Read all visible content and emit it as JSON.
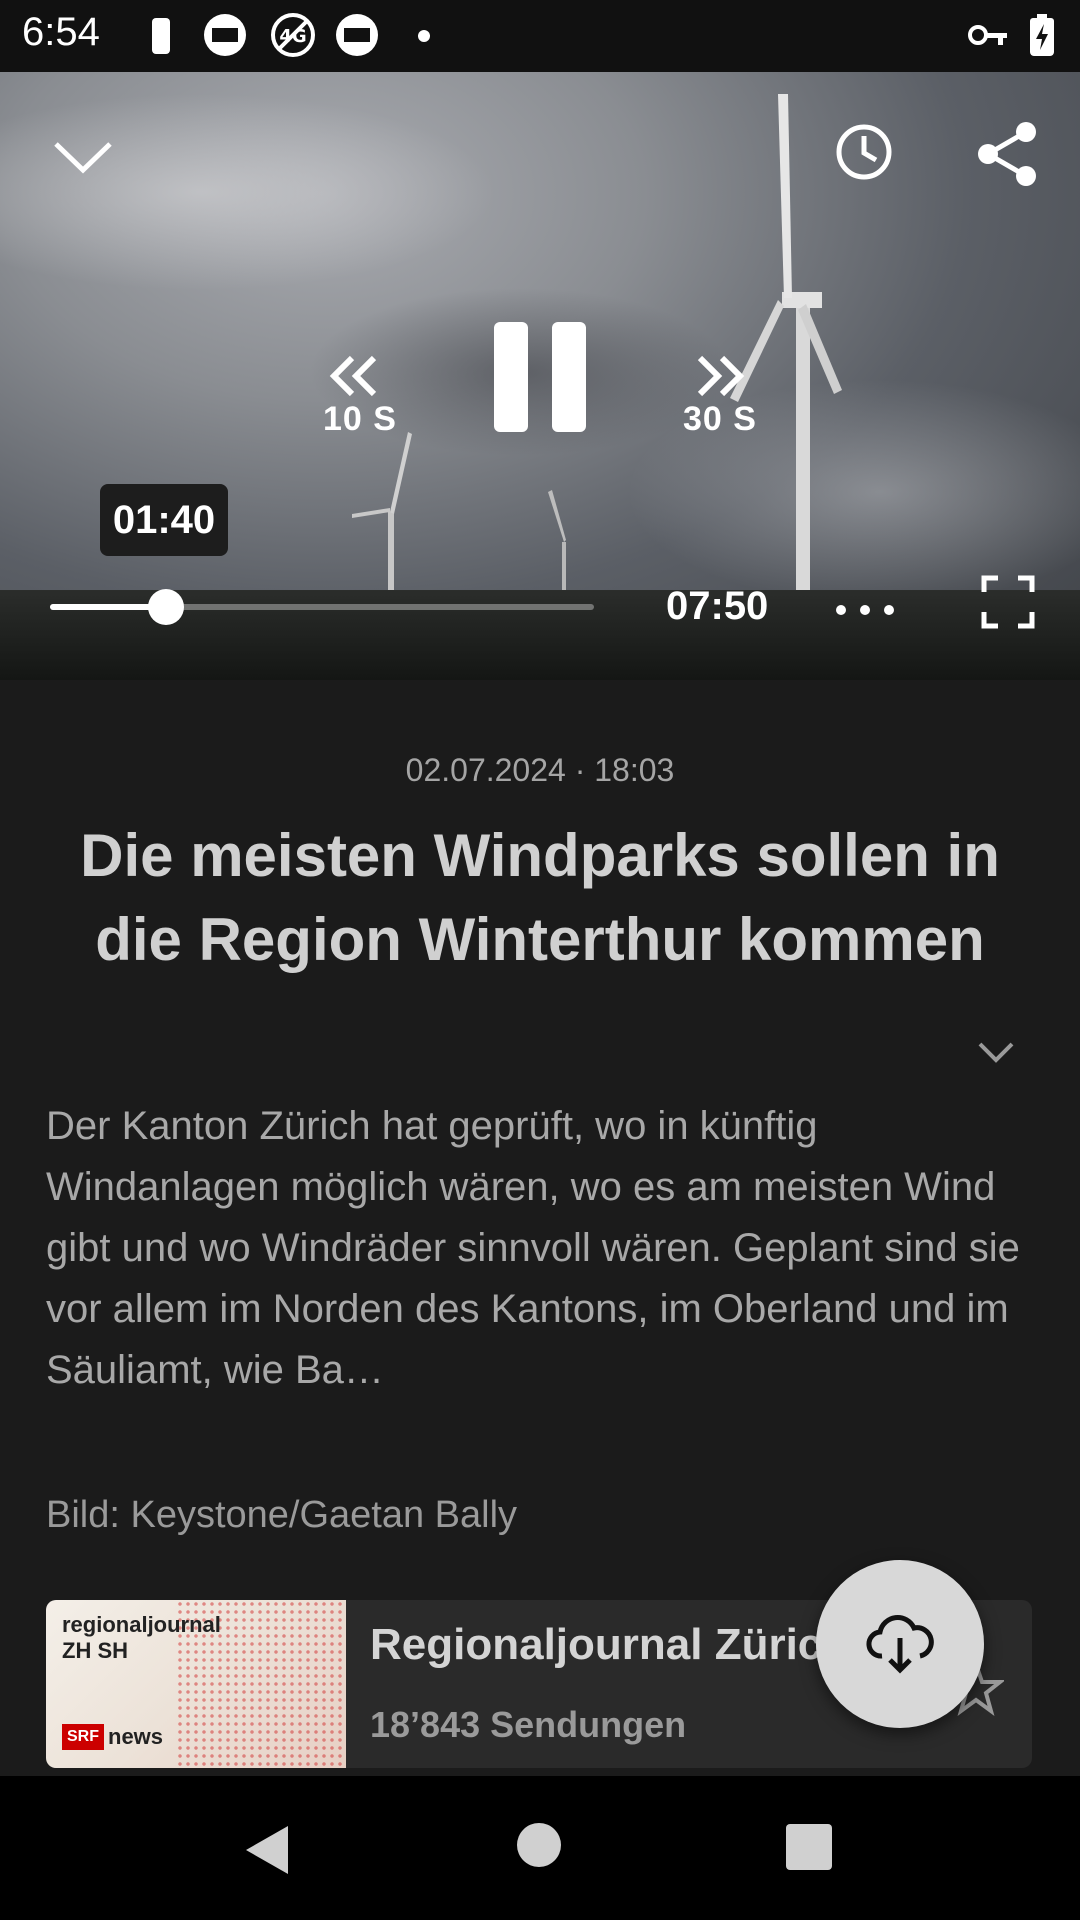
{
  "status_bar": {
    "time": "6:54"
  },
  "player": {
    "rewind_label": "10 S",
    "forward_label": "30 S",
    "seek_tooltip": "01:40",
    "duration": "07:50",
    "progress_fraction": 0.213
  },
  "episode": {
    "datetime": "02.07.2024 · 18:03",
    "title": "Die meisten Windparks sollen in die Region Winterthur kommen",
    "description": "Der Kanton Zürich hat geprüft, wo in künftig Windanlagen möglich wären, wo es am meisten Wind gibt und wo Windräder sinnvoll wären. Geplant sind sie vor allem im Norden des Kantons, im Oberland und im Säuliamt, wie Ba…",
    "image_credit": "Bild: Keystone/Gaetan Bally"
  },
  "show": {
    "thumb_line1": "regionaljournal",
    "thumb_line2": "ZH SH",
    "logo_srf": "SRF",
    "logo_news": "news",
    "title": "Regionaljournal Züric",
    "subtitle": "18’843 Sendungen"
  },
  "icons": {
    "collapse": "chevron-down-icon",
    "history": "clock-icon",
    "share": "share-icon",
    "rewind": "rewind-icon",
    "pause": "pause-icon",
    "forward": "fast-forward-icon",
    "more": "more-horizontal-icon",
    "fullscreen": "fullscreen-icon",
    "expand": "chevron-down-icon",
    "download": "cloud-download-icon",
    "favorite": "star-icon"
  }
}
